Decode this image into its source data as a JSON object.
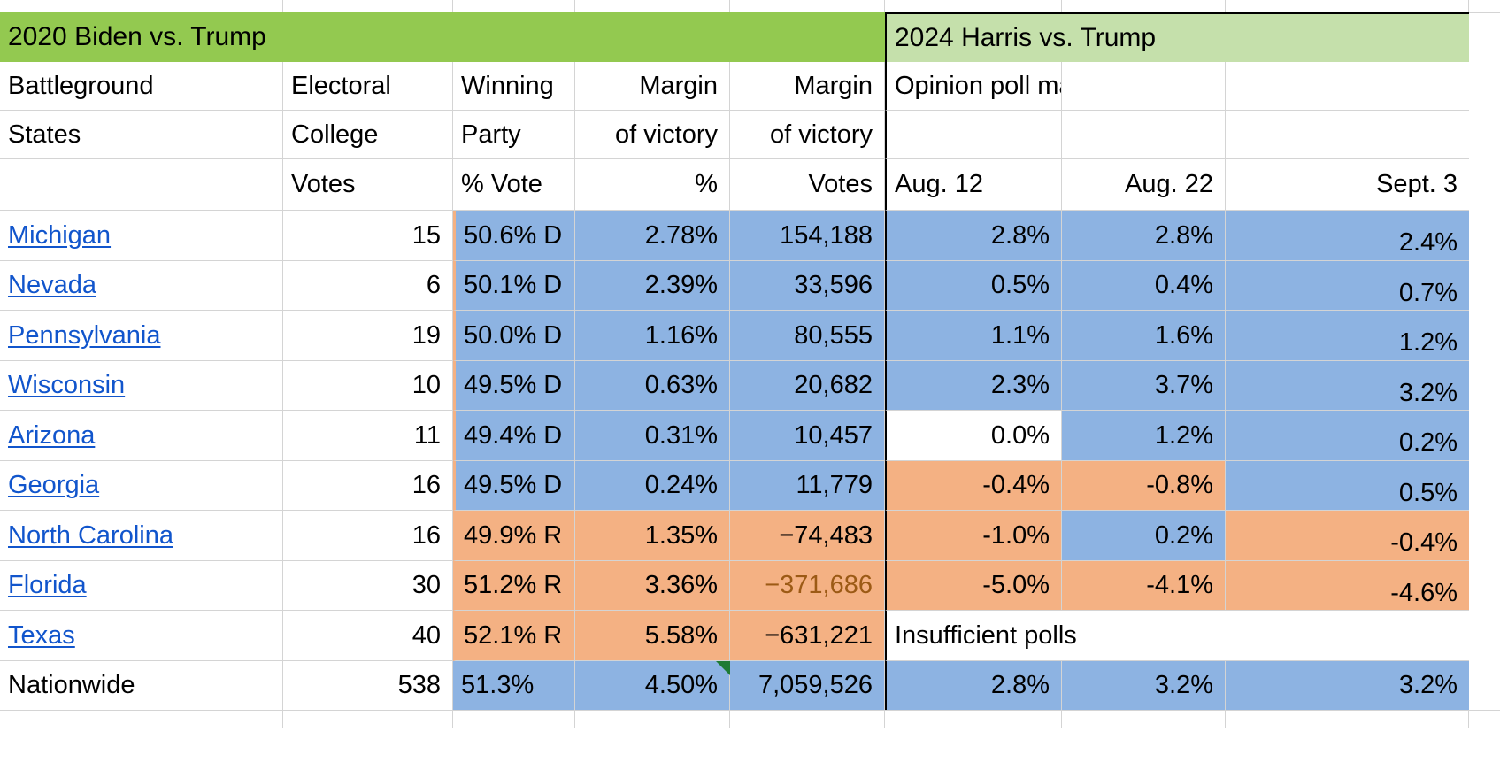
{
  "banners": {
    "left": "2020 Biden vs. Trump",
    "right": "2024 Harris vs. Trump"
  },
  "headers": {
    "state_l1": "Battleground",
    "state_l2": "States",
    "state_l3": "",
    "ecv_l1": "Electoral",
    "ecv_l2": "College",
    "ecv_l3": "Votes",
    "party_l1": "Winning",
    "party_l2": "Party",
    "party_l3": "% Vote",
    "marginpct_l1": "Margin",
    "marginpct_l2": "of victory",
    "marginpct_l3": "%",
    "marginvotes_l1": "Margin",
    "marginvotes_l2": "of victory",
    "marginvotes_l3": "Votes",
    "polls_l1": "Opinion poll margins",
    "poll_date_1": "Aug. 12",
    "poll_date_2": "Aug. 22",
    "poll_date_3": "Sept. 3"
  },
  "rows": [
    {
      "state": "Michigan",
      "ecv": "15",
      "party": "50.6% D",
      "margin_pct": "2.78%",
      "margin_votes": "154,188",
      "party_fill": "blue",
      "pct_fill": "blue",
      "votes_fill": "blue",
      "polls": [
        "2.8%",
        "2.8%",
        "2.4%"
      ],
      "poll_fills": [
        "blue",
        "blue",
        "blue"
      ]
    },
    {
      "state": "Nevada",
      "ecv": "6",
      "party": "50.1% D",
      "margin_pct": "2.39%",
      "margin_votes": "33,596",
      "party_fill": "blue",
      "pct_fill": "blue",
      "votes_fill": "blue",
      "polls": [
        "0.5%",
        "0.4%",
        "0.7%"
      ],
      "poll_fills": [
        "blue",
        "blue",
        "blue"
      ]
    },
    {
      "state": "Pennsylvania",
      "ecv": "19",
      "party": "50.0% D",
      "margin_pct": "1.16%",
      "margin_votes": "80,555",
      "party_fill": "blue",
      "pct_fill": "blue",
      "votes_fill": "blue",
      "polls": [
        "1.1%",
        "1.6%",
        "1.2%"
      ],
      "poll_fills": [
        "blue",
        "blue",
        "blue"
      ]
    },
    {
      "state": "Wisconsin",
      "ecv": "10",
      "party": "49.5% D",
      "margin_pct": "0.63%",
      "margin_votes": "20,682",
      "party_fill": "blue",
      "pct_fill": "blue",
      "votes_fill": "blue",
      "polls": [
        "2.3%",
        "3.7%",
        "3.2%"
      ],
      "poll_fills": [
        "blue",
        "blue",
        "blue"
      ]
    },
    {
      "state": "Arizona",
      "ecv": "11",
      "party": "49.4% D",
      "margin_pct": "0.31%",
      "margin_votes": "10,457",
      "party_fill": "blue",
      "pct_fill": "blue",
      "votes_fill": "blue",
      "polls": [
        "0.0%",
        "1.2%",
        "0.2%"
      ],
      "poll_fills": [
        "white",
        "blue",
        "blue"
      ]
    },
    {
      "state": "Georgia",
      "ecv": "16",
      "party": "49.5% D",
      "margin_pct": "0.24%",
      "margin_votes": "11,779",
      "party_fill": "blue",
      "pct_fill": "blue",
      "votes_fill": "blue",
      "polls": [
        "-0.4%",
        "-0.8%",
        "0.5%"
      ],
      "poll_fills": [
        "orange",
        "orange",
        "blue"
      ]
    },
    {
      "state": "North Carolina",
      "ecv": "16",
      "party": "49.9% R",
      "margin_pct": "1.35%",
      "margin_votes": "−74,483",
      "party_fill": "orange",
      "pct_fill": "orange",
      "votes_fill": "orange",
      "polls": [
        "-1.0%",
        "0.2%",
        "-0.4%"
      ],
      "poll_fills": [
        "orange",
        "blue",
        "orange"
      ]
    },
    {
      "state": "Florida",
      "ecv": "30",
      "party": "51.2% R",
      "margin_pct": "3.36%",
      "margin_votes": "−371,686",
      "party_fill": "orange",
      "pct_fill": "orange",
      "votes_fill": "orange",
      "votes_text_color": "brown",
      "polls": [
        "-5.0%",
        "-4.1%",
        "-4.6%"
      ],
      "poll_fills": [
        "orange",
        "orange",
        "orange"
      ]
    },
    {
      "state": "Texas",
      "ecv": "40",
      "party": "52.1% R",
      "margin_pct": "5.58%",
      "margin_votes": "−631,221",
      "party_fill": "orange",
      "pct_fill": "orange",
      "votes_fill": "orange",
      "polls_merged": "Insufficient polls",
      "poll_fills": [
        "white",
        "white",
        "white"
      ]
    }
  ],
  "total_row": {
    "state": "Nationwide",
    "ecv": "538",
    "party": "51.3%",
    "margin_pct": "4.50%",
    "margin_votes": "7,059,526",
    "fill": "blue",
    "polls": [
      "2.8%",
      "3.2%",
      "3.2%"
    ],
    "poll_fills": [
      "blue",
      "blue",
      "blue"
    ],
    "has_comment_marker": true
  },
  "colors": {
    "banner_left": "#93c950",
    "banner_right": "#c5e0ab",
    "democrat_blue": "#8db3e2",
    "republican_orange": "#f4b183",
    "link_blue": "#1155cc",
    "gridline": "#d4d4d4",
    "comment_marker_green": "#1e7b34",
    "brown_text": "#9c5a15"
  },
  "icons": {
    "comment_marker": "comment-marker-triangle",
    "selection_corner": "selection-corner"
  }
}
